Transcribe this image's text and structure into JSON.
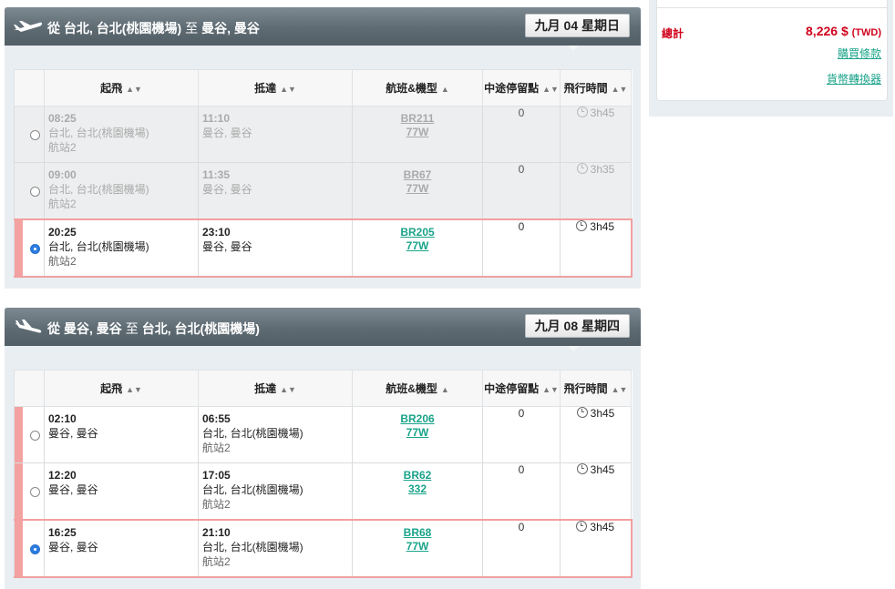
{
  "summary": {
    "total_label": "總計",
    "total_amount": "8,226 $",
    "currency": "(TWD)",
    "terms_link": "購買條款",
    "converter_link": "貨幣轉換器"
  },
  "columns": {
    "departure": "起飛",
    "arrival": "抵達",
    "flight_aircraft": "航班&機型",
    "stops": "中途停留點",
    "duration": "飛行時間"
  },
  "outbound": {
    "from_kw": "從",
    "origin": "台北, 台北(桃園機場)",
    "to_kw": "至",
    "destination": "曼谷, 曼谷",
    "date": "九月 04 星期日",
    "flights": [
      {
        "dep_time": "08:25",
        "dep_place": "台北, 台北(桃園機場)",
        "dep_terminal": "航站2",
        "arr_time": "11:10",
        "arr_place": "曼谷, 曼谷",
        "arr_terminal": "",
        "flight": "BR211",
        "aircraft": "77W",
        "stops": "0",
        "duration": "3h45",
        "state": "disabled"
      },
      {
        "dep_time": "09:00",
        "dep_place": "台北, 台北(桃園機場)",
        "dep_terminal": "航站2",
        "arr_time": "11:35",
        "arr_place": "曼谷, 曼谷",
        "arr_terminal": "",
        "flight": "BR67",
        "aircraft": "77W",
        "stops": "0",
        "duration": "3h35",
        "state": "disabled"
      },
      {
        "dep_time": "20:25",
        "dep_place": "台北, 台北(桃園機場)",
        "dep_terminal": "航站2",
        "arr_time": "23:10",
        "arr_place": "曼谷, 曼谷",
        "arr_terminal": "",
        "flight": "BR205",
        "aircraft": "77W",
        "stops": "0",
        "duration": "3h45",
        "state": "selected"
      }
    ]
  },
  "inbound": {
    "from_kw": "從",
    "origin": "曼谷, 曼谷",
    "to_kw": "至",
    "destination": "台北, 台北(桃園機場)",
    "date": "九月 08 星期四",
    "flights": [
      {
        "dep_time": "02:10",
        "dep_place": "曼谷, 曼谷",
        "dep_terminal": "",
        "arr_time": "06:55",
        "arr_place": "台北, 台北(桃園機場)",
        "arr_terminal": "航站2",
        "flight": "BR206",
        "aircraft": "77W",
        "stops": "0",
        "duration": "3h45",
        "state": "available"
      },
      {
        "dep_time": "12:20",
        "dep_place": "曼谷, 曼谷",
        "dep_terminal": "",
        "arr_time": "17:05",
        "arr_place": "台北, 台北(桃園機場)",
        "arr_terminal": "航站2",
        "flight": "BR62",
        "aircraft": "332",
        "stops": "0",
        "duration": "3h45",
        "state": "available"
      },
      {
        "dep_time": "16:25",
        "dep_place": "曼谷, 曼谷",
        "dep_terminal": "",
        "arr_time": "21:10",
        "arr_place": "台北, 台北(桃園機場)",
        "arr_terminal": "航站2",
        "flight": "BR68",
        "aircraft": "77W",
        "stops": "0",
        "duration": "3h45",
        "state": "selected"
      }
    ]
  },
  "colors": {
    "accent_link": "#1aa38a",
    "price_red": "#d0021b",
    "selected_border": "#f2a0a0",
    "radio_selected": "#2b7de3",
    "header_bar": "#5e6b73"
  },
  "icons": {
    "outbound_plane": "takeoff-plane-icon",
    "inbound_plane": "landing-plane-icon",
    "sort": "sort-arrows-icon",
    "duration": "clock-icon"
  }
}
